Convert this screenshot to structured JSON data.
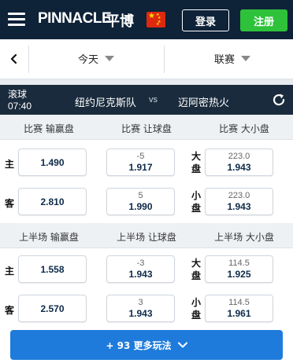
{
  "header": {
    "logo_text": "PINNACLE",
    "logo_cn": "平博",
    "flag_icon": "china-flag-icon",
    "login_label": "登录",
    "register_label": "注册"
  },
  "filter": {
    "date_label": "今天",
    "league_label": "联赛"
  },
  "match": {
    "status": "滚球",
    "time": "07:40",
    "home": "纽约尼克斯队",
    "vs": "vs",
    "away": "迈阿密热火"
  },
  "full_game": {
    "titles": [
      "比赛 输赢盘",
      "比赛 让球盘",
      "比赛 大小盘"
    ],
    "rows": [
      {
        "side": "主",
        "ml": "1.490",
        "hcp_line": "-5",
        "hcp_price": "1.917",
        "ou_side_1": "大",
        "ou_side_2": "盘",
        "ou_line": "223.0",
        "ou_price": "1.943"
      },
      {
        "side": "客",
        "ml": "2.810",
        "hcp_line": "5",
        "hcp_price": "1.990",
        "ou_side_1": "小",
        "ou_side_2": "盘",
        "ou_line": "223.0",
        "ou_price": "1.943"
      }
    ]
  },
  "first_half": {
    "titles": [
      "上半场 输赢盘",
      "上半场 让球盘",
      "上半场 大小盘"
    ],
    "rows": [
      {
        "side": "主",
        "ml": "1.558",
        "hcp_line": "-3",
        "hcp_price": "1.943",
        "ou_side_1": "大",
        "ou_side_2": "盘",
        "ou_line": "114.5",
        "ou_price": "1.925"
      },
      {
        "side": "客",
        "ml": "2.570",
        "hcp_line": "3",
        "hcp_price": "1.943",
        "ou_side_1": "小",
        "ou_side_2": "盘",
        "ou_line": "114.5",
        "ou_price": "1.961"
      }
    ]
  },
  "more_button": "+ 93 更多玩法",
  "colors": {
    "header_bg": "#0e2238",
    "register_green": "#2ec23a",
    "match_bar": "#1a2b3d",
    "more_blue": "#1e7bdb"
  }
}
